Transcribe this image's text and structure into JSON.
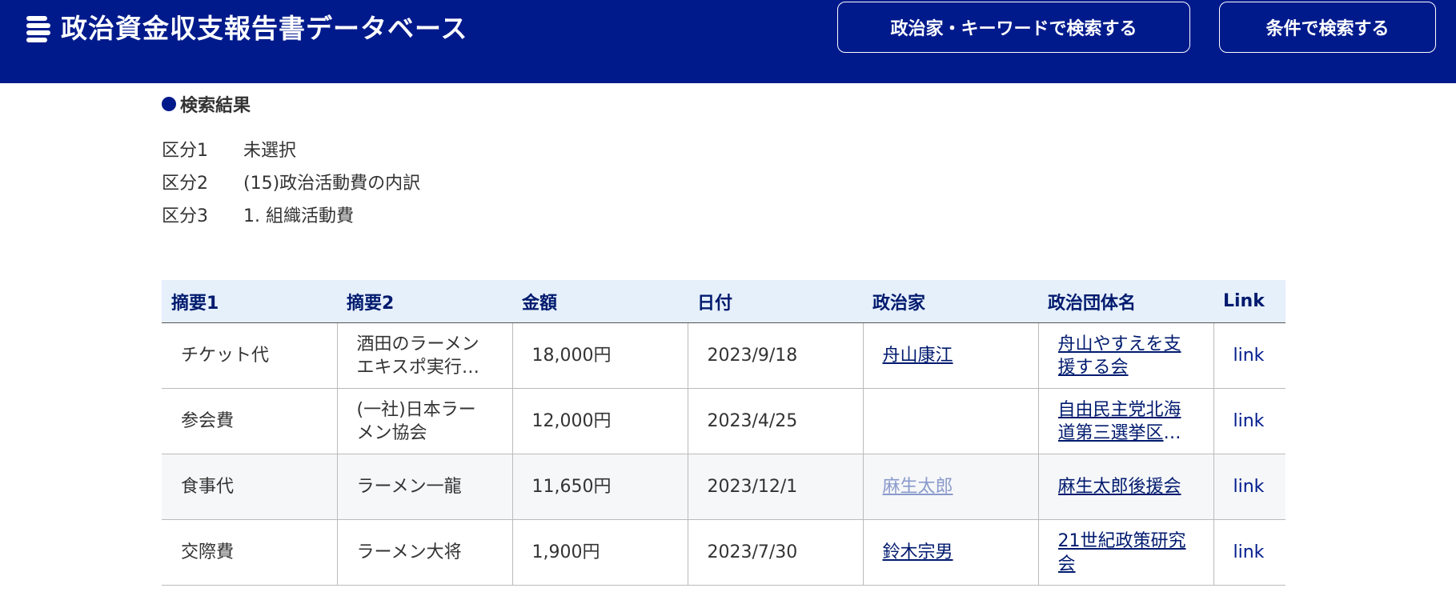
{
  "header": {
    "title": "政治資金収支報告書データベース",
    "keyword_search_label": "政治家・キーワードで検索する",
    "condition_search_label": "条件で検索する"
  },
  "results": {
    "heading": "検索結果",
    "filters": [
      {
        "label": "区分1",
        "value": "未選択"
      },
      {
        "label": "区分2",
        "value": "(15)政治活動費の内訳"
      },
      {
        "label": "区分3",
        "value": "1. 組織活動費"
      }
    ]
  },
  "table": {
    "columns": [
      "摘要1",
      "摘要2",
      "金額",
      "日付",
      "政治家",
      "政治団体名",
      "Link"
    ],
    "rows": [
      {
        "summary1": "チケット代",
        "summary2": "酒田のラーメンエキスポ実行委員会",
        "amount": "18,000円",
        "date": "2023/9/18",
        "politician": "舟山康江",
        "organization": "舟山やすえを支援する会",
        "link": "link"
      },
      {
        "summary1": "参会費",
        "summary2": "(一社)日本ラーメン協会",
        "amount": "12,000円",
        "date": "2023/4/25",
        "politician": "",
        "organization": "自由民主党北海道第三選挙区支部",
        "link": "link"
      },
      {
        "summary1": "食事代",
        "summary2": "ラーメン一龍",
        "amount": "11,650円",
        "date": "2023/12/1",
        "politician": "麻生太郎",
        "organization": "麻生太郎後援会",
        "link": "link"
      },
      {
        "summary1": "交際費",
        "summary2": "ラーメン大将",
        "amount": "1,900円",
        "date": "2023/7/30",
        "politician": "鈴木宗男",
        "organization": "21世紀政策研究会",
        "link": "link"
      }
    ]
  },
  "colors": {
    "header_bg": "#001a8c",
    "table_header_bg": "#e6f0fb",
    "link_color": "#001a6e",
    "visited_link_color": "#8a9acb"
  }
}
